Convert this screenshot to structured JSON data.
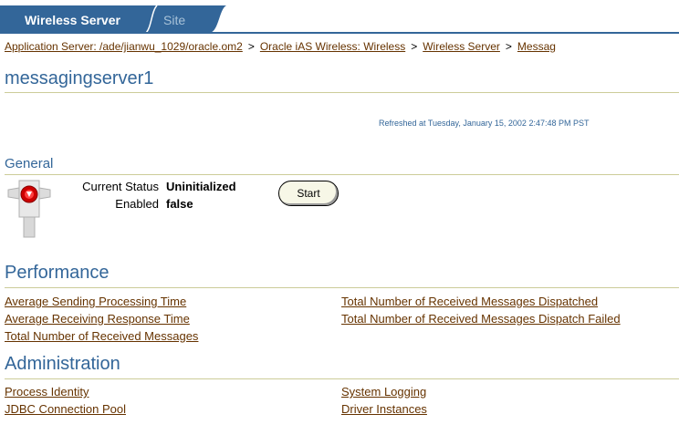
{
  "tabs": {
    "active": "Wireless Server",
    "inactive": "Site"
  },
  "breadcrumb": {
    "items": [
      "Application Server: /ade/jianwu_1029/oracle.om2",
      "Oracle iAS Wireless: Wireless",
      "Wireless Server",
      "Messag"
    ],
    "separator": ">"
  },
  "page": {
    "title": "messagingserver1"
  },
  "refreshed": "Refreshed at Tuesday, January 15, 2002 2:47:48 PM PST",
  "general": {
    "heading": "General",
    "status_label": "Current Status",
    "status_value": "Uninitialized",
    "enabled_label": "Enabled",
    "enabled_value": "false",
    "start_button": "Start",
    "status_icon": "stoplight-down-icon"
  },
  "performance": {
    "heading": "Performance",
    "left_links": [
      "Average Sending Processing Time",
      "Average Receiving Response Time",
      "Total Number of Received Messages"
    ],
    "right_links": [
      "Total Number of Received Messages Dispatched",
      "Total Number of Received Messages Dispatch Failed"
    ]
  },
  "administration": {
    "heading": "Administration",
    "left_links": [
      "Process Identity",
      "JDBC Connection Pool"
    ],
    "right_links": [
      "System Logging",
      "Driver Instances"
    ]
  },
  "colors": {
    "heading": "#336699",
    "link": "#663300",
    "rule": "#cccc99",
    "tab": "#336699"
  }
}
